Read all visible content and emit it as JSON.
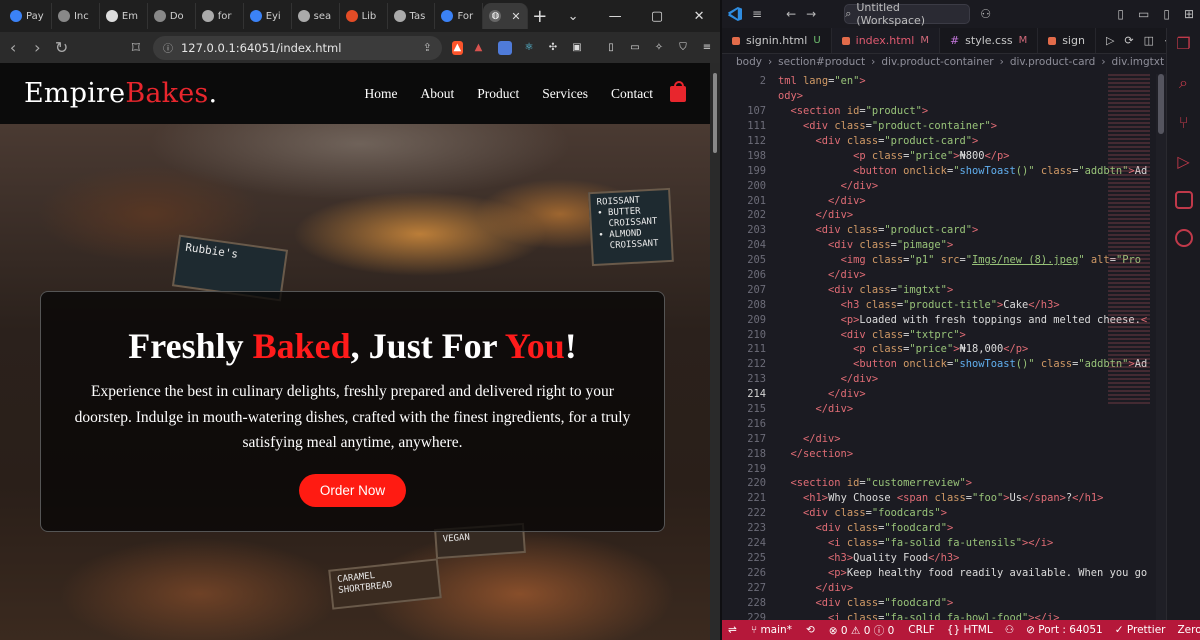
{
  "browser": {
    "tabs": [
      {
        "label": "Pay",
        "icon": "globe-icon",
        "color": "#3b82f6"
      },
      {
        "label": "Inc",
        "icon": "globe-icon",
        "color": "#888888"
      },
      {
        "label": "Em",
        "icon": "github-icon",
        "color": "#dddddd"
      },
      {
        "label": "Do",
        "icon": "globe-icon",
        "color": "#888888"
      },
      {
        "label": "for",
        "icon": "grid-icon",
        "color": "#aaaaaa"
      },
      {
        "label": "Eyi",
        "icon": "flag-icon",
        "color": "#3b82f6"
      },
      {
        "label": "sea",
        "icon": "globe-icon",
        "color": "#aaaaaa"
      },
      {
        "label": "Lib",
        "icon": "code-icon",
        "color": "#e34c26"
      },
      {
        "label": "Tas",
        "icon": "globe-icon",
        "color": "#aaaaaa"
      },
      {
        "label": "For",
        "icon": "flag-icon",
        "color": "#3b82f6"
      }
    ],
    "url": "127.0.0.1:64051/index.html"
  },
  "site": {
    "logo_main": "Empire",
    "logo_accent": "Bakes",
    "logo_dot": ".",
    "menu": [
      "Home",
      "About",
      "Product",
      "Services",
      "Contact"
    ],
    "hero": {
      "title_1": "Freshly ",
      "title_red_1": "Baked",
      "title_2": ", Just For ",
      "title_red_2": "You",
      "title_3": "!",
      "text": "Experience the best in culinary delights, freshly prepared and delivered right to your doorstep. Indulge in mouth-watering dishes, crafted with the finest ingredients, for a truly satisfying meal anytime, anywhere.",
      "button": "Order Now"
    },
    "signs": {
      "s1": "ROISSANT\n• BUTTER\n  CROISSANT\n• ALMOND\n  CROISSANT",
      "s2": "Rubbie's",
      "s3": "CARAMEL\nSHORTBREAD",
      "s4": "VEGAN"
    }
  },
  "vscode": {
    "search": "Untitled (Workspace)",
    "tabs": [
      {
        "label": "signin.html",
        "mark": "U"
      },
      {
        "label": "index.html",
        "mark": "M"
      },
      {
        "label": "style.css",
        "mark": "M"
      },
      {
        "label": "sign",
        "mark": ""
      }
    ],
    "breadcrumb": [
      "body",
      "section#product",
      "div.product-container",
      "div.product-card",
      "div.imgtxt"
    ],
    "lines": [
      {
        "n": "2",
        "html": "<span class=\"tag\">tml</span> <span class=\"attr\">lang</span>=<span class=\"str\">\"en\"</span><span class=\"tag\">&gt;</span>"
      },
      {
        "n": "",
        "html": "<span class=\"tag\">ody&gt;</span>"
      },
      {
        "n": "107",
        "html": "  <span class=\"tag\">&lt;section</span> <span class=\"attr\">id</span>=<span class=\"str\">\"product\"</span><span class=\"tag\">&gt;</span>"
      },
      {
        "n": "111",
        "html": "    <span class=\"tag\">&lt;div</span> <span class=\"attr\">class</span>=<span class=\"str\">\"product-container\"</span><span class=\"tag\">&gt;</span>"
      },
      {
        "n": "112",
        "html": "      <span class=\"tag\">&lt;div</span> <span class=\"attr\">class</span>=<span class=\"str\">\"product-card\"</span><span class=\"tag\">&gt;</span>"
      },
      {
        "n": "198",
        "html": "            <span class=\"tag\">&lt;p</span> <span class=\"attr\">class</span>=<span class=\"str\">\"price\"</span><span class=\"tag\">&gt;</span><span class=\"txt\">₦800</span><span class=\"tag\">&lt;/p&gt;</span>"
      },
      {
        "n": "199",
        "html": "            <span class=\"tag\">&lt;button</span> <span class=\"attr\">onclick</span>=<span class=\"str\">\"<span class=\"fn\">showToast</span>()\"</span> <span class=\"attr\">class</span>=<span class=\"str\">\"addbtn\"</span><span class=\"tag\">&gt;</span>Ad"
      },
      {
        "n": "200",
        "html": "          <span class=\"tag\">&lt;/div&gt;</span>"
      },
      {
        "n": "201",
        "html": "        <span class=\"tag\">&lt;/div&gt;</span>"
      },
      {
        "n": "202",
        "html": "      <span class=\"tag\">&lt;/div&gt;</span>"
      },
      {
        "n": "203",
        "html": "      <span class=\"tag\">&lt;div</span> <span class=\"attr\">class</span>=<span class=\"str\">\"product-card\"</span><span class=\"tag\">&gt;</span>"
      },
      {
        "n": "204",
        "html": "        <span class=\"tag\">&lt;div</span> <span class=\"attr\">class</span>=<span class=\"str\">\"pimage\"</span><span class=\"tag\">&gt;</span>"
      },
      {
        "n": "205",
        "html": "          <span class=\"tag\">&lt;img</span> <span class=\"attr\">class</span>=<span class=\"str\">\"p1\"</span> <span class=\"attr\">src</span>=<span class=\"str\">\"<u>Imgs/new (8).jpeg</u>\"</span> <span class=\"attr\">alt</span>=<span class=\"str\">\"Pro</span>"
      },
      {
        "n": "206",
        "html": "        <span class=\"tag\">&lt;/div&gt;</span>"
      },
      {
        "n": "207",
        "html": "        <span class=\"tag\">&lt;div</span> <span class=\"attr\">class</span>=<span class=\"str\">\"imgtxt\"</span><span class=\"tag\">&gt;</span>"
      },
      {
        "n": "208",
        "html": "          <span class=\"tag\">&lt;h3</span> <span class=\"attr\">class</span>=<span class=\"str\">\"product-title\"</span><span class=\"tag\">&gt;</span><span class=\"txt\">Cake</span><span class=\"tag\">&lt;/h3&gt;</span>"
      },
      {
        "n": "209",
        "html": "          <span class=\"tag\">&lt;p&gt;</span><span class=\"txt\">Loaded with fresh toppings and melted cheese.</span><span class=\"tag\">&lt;</span>"
      },
      {
        "n": "210",
        "html": "          <span class=\"tag\">&lt;div</span> <span class=\"attr\">class</span>=<span class=\"str\">\"txtprc\"</span><span class=\"tag\">&gt;</span>"
      },
      {
        "n": "211",
        "html": "            <span class=\"tag\">&lt;p</span> <span class=\"attr\">class</span>=<span class=\"str\">\"price\"</span><span class=\"tag\">&gt;</span><span class=\"txt\">₦18,000</span><span class=\"tag\">&lt;/p&gt;</span>"
      },
      {
        "n": "212",
        "html": "            <span class=\"tag\">&lt;button</span> <span class=\"attr\">onclick</span>=<span class=\"str\">\"<span class=\"fn\">showToast</span>()\"</span> <span class=\"attr\">class</span>=<span class=\"str\">\"addbtn\"</span><span class=\"tag\">&gt;</span>Ad"
      },
      {
        "n": "213",
        "html": "          <span class=\"tag\">&lt;/div&gt;</span>"
      },
      {
        "n": "214",
        "html": "        <span class=\"tag\">&lt;/div&gt;</span>"
      },
      {
        "n": "215",
        "html": "      <span class=\"tag\">&lt;/div&gt;</span>"
      },
      {
        "n": "216",
        "html": ""
      },
      {
        "n": "217",
        "html": "    <span class=\"tag\">&lt;/div&gt;</span>"
      },
      {
        "n": "218",
        "html": "  <span class=\"tag\">&lt;/section&gt;</span>"
      },
      {
        "n": "219",
        "html": ""
      },
      {
        "n": "220",
        "html": "  <span class=\"tag\">&lt;section</span> <span class=\"attr\">id</span>=<span class=\"str\">\"customerreview\"</span><span class=\"tag\">&gt;</span>"
      },
      {
        "n": "221",
        "html": "    <span class=\"tag\">&lt;h1&gt;</span><span class=\"txt\">Why Choose </span><span class=\"tag\">&lt;span</span> <span class=\"attr\">class</span>=<span class=\"str\">\"foo\"</span><span class=\"tag\">&gt;</span><span class=\"txt\">Us</span><span class=\"tag\">&lt;/span&gt;</span><span class=\"txt\">?</span><span class=\"tag\">&lt;/h1&gt;</span>"
      },
      {
        "n": "222",
        "html": "    <span class=\"tag\">&lt;div</span> <span class=\"attr\">class</span>=<span class=\"str\">\"foodcards\"</span><span class=\"tag\">&gt;</span>"
      },
      {
        "n": "223",
        "html": "      <span class=\"tag\">&lt;div</span> <span class=\"attr\">class</span>=<span class=\"str\">\"foodcard\"</span><span class=\"tag\">&gt;</span>"
      },
      {
        "n": "224",
        "html": "        <span class=\"tag\">&lt;i</span> <span class=\"attr\">class</span>=<span class=\"str\">\"fa-solid fa-utensils\"</span><span class=\"tag\">&gt;&lt;/i&gt;</span>"
      },
      {
        "n": "225",
        "html": "        <span class=\"tag\">&lt;h3&gt;</span><span class=\"txt\">Quality Food</span><span class=\"tag\">&lt;/h3&gt;</span>"
      },
      {
        "n": "226",
        "html": "        <span class=\"tag\">&lt;p&gt;</span><span class=\"txt\">Keep healthy food readily available. When you go</span>"
      },
      {
        "n": "227",
        "html": "      <span class=\"tag\">&lt;/div&gt;</span>"
      },
      {
        "n": "228",
        "html": "      <span class=\"tag\">&lt;div</span> <span class=\"attr\">class</span>=<span class=\"str\">\"foodcard\"</span><span class=\"tag\">&gt;</span>"
      },
      {
        "n": "229",
        "html": "        <span class=\"tag\">&lt;i</span> <span class=\"attr\">class</span>=<span class=\"str\">\"fa-solid fa-bowl-food\"</span><span class=\"tag\">&gt;&lt;/i&gt;</span>"
      }
    ],
    "current_line": "214",
    "status": {
      "branch": "main*",
      "errors": "0",
      "warnings": "0",
      "info": "0",
      "eol": "CRLF",
      "language": "HTML",
      "port": "Port : 64051",
      "prettier": "Prettier",
      "theme": "Zero Two"
    }
  }
}
